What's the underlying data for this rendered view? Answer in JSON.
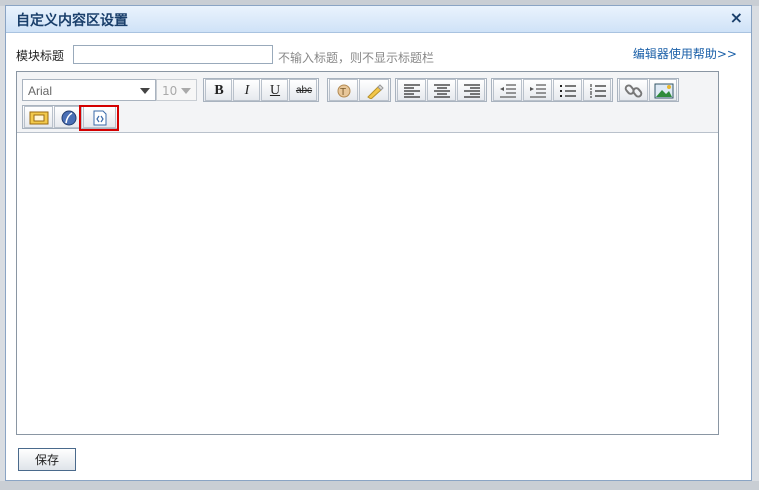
{
  "dialog": {
    "title": "自定义内容区设置",
    "close_glyph": "×",
    "module_title_label": "模块标题",
    "module_title_value": "",
    "hint": "不输入标题，则不显示标题栏",
    "help_link": "编辑器使用帮助>>",
    "save_label": "保存"
  },
  "toolbar": {
    "font_family": "Arial",
    "font_size": "10",
    "bold": "B",
    "italic": "I",
    "underline": "U",
    "strike": "abc",
    "buttons_row1": [
      "font-color-icon",
      "highlight-pen-icon",
      "align-left-icon",
      "align-center-icon",
      "align-right-icon",
      "outdent-icon",
      "indent-icon",
      "bullet-list-icon",
      "numbered-list-icon",
      "link-icon",
      "image-icon"
    ],
    "buttons_row2": [
      "media-icon",
      "flash-icon",
      "source-code-icon"
    ],
    "highlighted_button": "source-code-icon"
  },
  "colors": {
    "title_text": "#1a3f6b",
    "highlight_border": "#d40000",
    "help_link": "#1a5fa8"
  }
}
